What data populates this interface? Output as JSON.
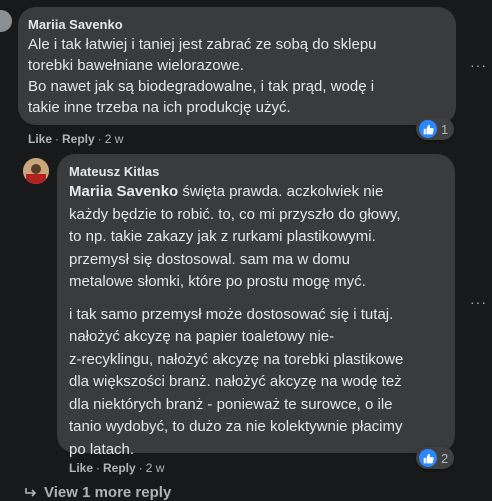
{
  "comments": [
    {
      "author": "Mariia Savenko",
      "lines": [
        "Ale i tak łatwiej i taniej jest zabrać ze sobą do sklepu",
        "torebki bawełniane wielorazowe.",
        "Bo nawet jak są biodegradowalne, i tak prąd, wodę i",
        "takie inne trzeba na ich produkcję użyć."
      ],
      "like_label": "Like",
      "reply_label": "Reply",
      "time": "2 w",
      "reaction_count": "1",
      "reaction_icon": "like-icon"
    },
    {
      "author": "Mateusz Kitlas",
      "mention": "Mariia Savenko",
      "first_line_rest": "święta prawda. aczkolwiek nie",
      "para1_lines": [
        "każdy będzie to robić. to, co mi przyszło do głowy,",
        "to np. takie zakazy jak z rurkami plastikowymi.",
        "przemysł się dostosowal. sam ma w domu",
        "metalowe słomki, które po prostu mogę myć."
      ],
      "para2_lines": [
        "i tak samo przemysł może dostosować się i tutaj.",
        "nałożyć akcyzę na papier toaletowy nie-",
        "z-recyklingu, nałożyć akcyzę na torebki plastikowe",
        "dla większości branż. nałożyć akcyzę na wodę też",
        "dla niektórych branż - ponieważ te surowce, o ile",
        "tanio wydobyć, to dużo za nie kolektywnie płacimy",
        "po latach."
      ],
      "like_label": "Like",
      "reply_label": "Reply",
      "time": "2 w",
      "reaction_count": "2",
      "reaction_icon": "like-icon"
    }
  ],
  "view_more": "View 1 more reply",
  "more_options": "···",
  "colors": {
    "background": "#18191a",
    "bubble": "#3a3b3c",
    "like_blue": "#2d88ff",
    "secondary_text": "#b0b3b8"
  }
}
